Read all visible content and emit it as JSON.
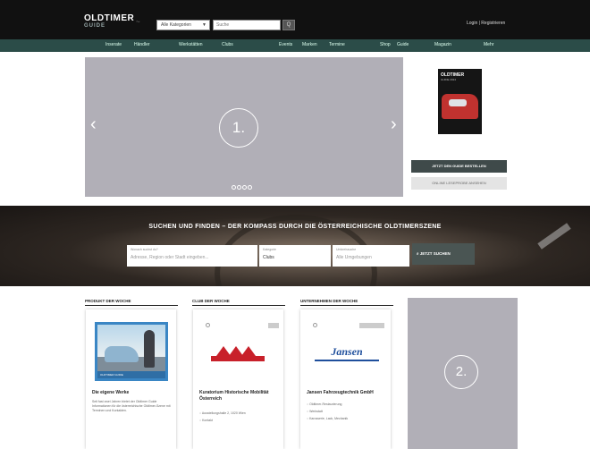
{
  "header": {
    "logo_main": "OLDTIMER",
    "logo_sub": "GUIDE",
    "logo_mark": "~",
    "category_select": "Alle Kategorien",
    "search_placeholder": "Suche",
    "search_button": "Q",
    "login": "Login | Registrieren"
  },
  "nav": {
    "items": [
      "Inserate",
      "Händler",
      "Werkstätten",
      "Clubs",
      "Events",
      "Marken",
      "Termine",
      "Shop",
      "Guide",
      "Magazin",
      "Mehr"
    ]
  },
  "hero": {
    "marker": "1.",
    "prev": "‹",
    "next": "›",
    "dot_count": 4,
    "active_dot": 1
  },
  "magazine": {
    "cover_title": "OLDTIMER",
    "cover_sub": "GUIDE 2024",
    "order_button": "JETZT DEN GUIDE BESTELLEN",
    "preview_button": "ONLINE LESEPROBE ANSEHEN"
  },
  "search_band": {
    "title": "SUCHEN UND FINDEN – DER KOMPASS DURCH DIE ÖSTERREICHISCHE OLDTIMERSZENE",
    "what_label": "Wonach suchst du?",
    "what_placeholder": "Adresse, Region oder Stadt eingeben...",
    "type_label": "Kategorie",
    "type_value": "Clubs",
    "where_label": "Umkreissuche",
    "where_placeholder": "Alle Umgebungen",
    "submit": "JETZT SUCHEN"
  },
  "sections": {
    "product_title": "PRODUKT DER WOCHE",
    "club_title": "CLUB DER WOCHE",
    "company_title": "UNTERNEHMEN DER WOCHE"
  },
  "product": {
    "banner": "OLDTIMER GUIDE",
    "title": "Die eigene Werke",
    "text": "Seit fast zwei Jahren bietet der Oldtimer Guide Informationen für die österreichische Oldtimer-Szene mit Terminen und Kontakten."
  },
  "club": {
    "title": "Kuratorium Historische Mobilität Österreich",
    "bullets": [
      "Ausstellungshalle 2, 1020 Wien",
      "Kontakt"
    ]
  },
  "company": {
    "logo": "Jansen",
    "title": "Jansen Fahrzeugtechnik GmbH",
    "bullets": [
      "Oldtimer-Restaurierung",
      "Werkstatt",
      "Karosserie, Lack, Mechanik"
    ]
  },
  "ad": {
    "marker": "2."
  },
  "colors": {
    "nav_bg": "#2b4c48",
    "placeholder": "#b1afb7",
    "button_dark": "#3f4a4a"
  }
}
